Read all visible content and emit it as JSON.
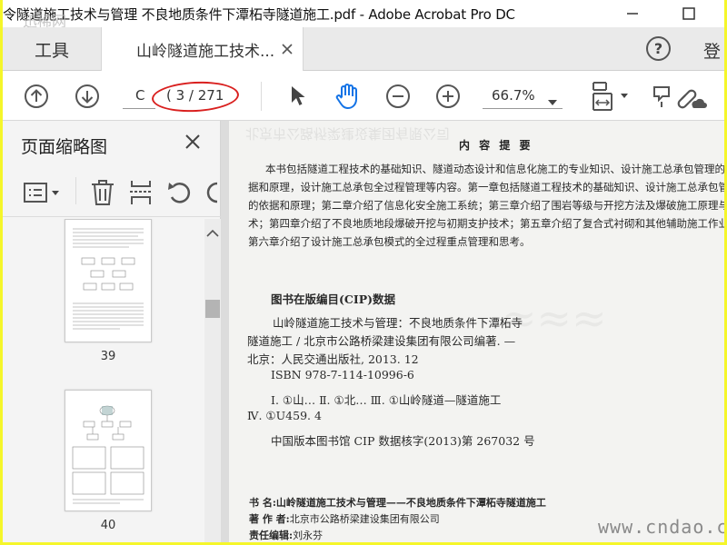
{
  "window": {
    "title": "令隧道施工技术与管理  不良地质条件下潭柘寺隧道施工.pdf - Adobe Acrobat Pro DC",
    "corner_watermark": "迅稀网"
  },
  "tabs": {
    "tools_label": "工具",
    "document_label": "山岭隧道施工技术...",
    "login_label": "登"
  },
  "toolbar": {
    "page_input_value": "C",
    "page_count": "( 3 / 271",
    "zoom_value": "66.7%"
  },
  "sidebar": {
    "title": "页面缩略图",
    "thumbnails": [
      {
        "label": "39"
      },
      {
        "label": "40"
      }
    ]
  },
  "page": {
    "summary_heading": "内 容 提 要",
    "summary_lines": [
      "本书包括隧道工程技术的基础知识、隧道动态设计和信息化施工的专业知识、设计施工总承包管理的依",
      "据和原理，设计施工总承包全过程管理等内容。第一章包括隧道工程技术的基础知识、设计施工总承包管理",
      "的依据和原理；第二章介绍了信息化安全施工系统；第三章介绍了围岩等级与开挖方法及爆破施工原理与技",
      "术；第四章介绍了不良地质地段爆破开挖与初期支护技术；第五章介绍了复合式衬砌和其他辅助施工作业；",
      "第六章介绍了设计施工总承包模式的全过程重点管理和思考。"
    ],
    "cip_heading": "图书在版编目(CIP)数据",
    "cip_lines": [
      "山岭隧道施工技术与管理：不良地质条件下潭柘寺",
      "隧道施工 / 北京市公路桥梁建设集团有限公司编著. —",
      "北京：人民交通出版社, 2013. 12",
      "ISBN  978-7-114-10996-6",
      "Ⅰ. ①山…   Ⅱ. ①北…   Ⅲ. ①山岭隧道—隧道施工",
      "Ⅳ. ①U459. 4",
      "中国版本图书馆 CIP 数据核字(2013)第 267032 号"
    ],
    "book_title_prefix": "书    名:",
    "book_title_value": "山岭隧道施工技术与管理——不良地质条件下潭柘寺隧道施工",
    "author_prefix": "著 作 者:",
    "author_value": "北京市公路桥梁建设集团有限公司",
    "editor_prefix": "责任编辑:",
    "editor_value": "刘永芬",
    "watermark": "www.cndao.com"
  },
  "colors": {
    "outer_border": "#f5f62a",
    "annotation_oval": "#d9201f",
    "hand_tool": "#1473e6"
  }
}
